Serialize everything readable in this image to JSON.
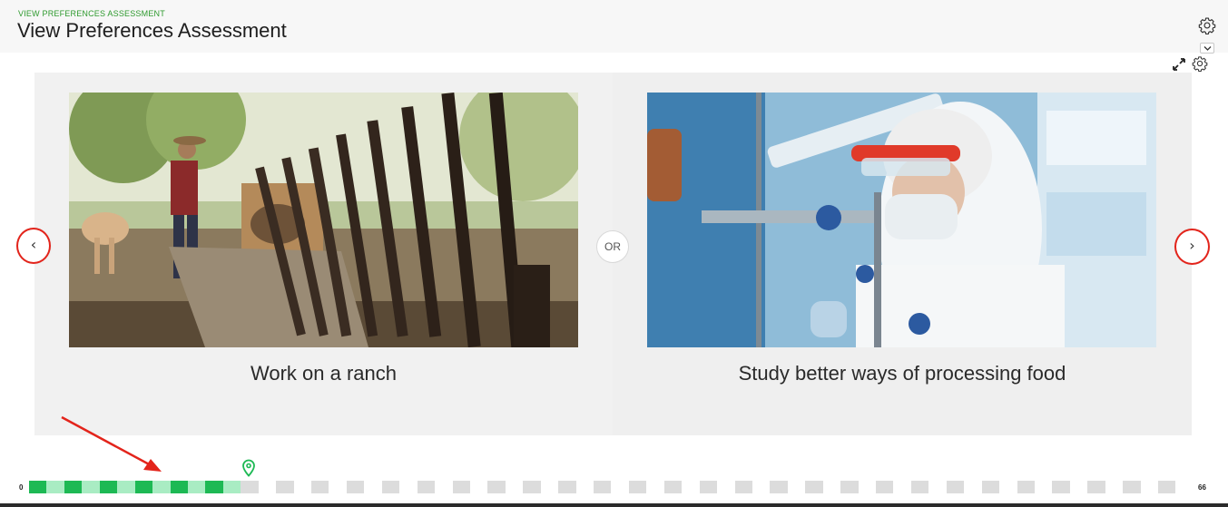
{
  "header": {
    "eyebrow": "VIEW PREFERENCES ASSESSMENT",
    "title": "View Preferences Assessment",
    "icons": [
      "gear-icon",
      "chevron-down-icon",
      "expand-icon",
      "gear-icon"
    ]
  },
  "comparison": {
    "left": {
      "caption": "Work on a ranch"
    },
    "separator": "OR",
    "right": {
      "caption": "Study better ways of processing food"
    }
  },
  "navigation": {
    "prev_symbol": "‹",
    "next_symbol": "›",
    "highlight_color": "#e3241b"
  },
  "progress": {
    "min_label": "0",
    "max_label": "66",
    "total_steps": 66,
    "completed_steps": 12,
    "colors": {
      "done_dark": "#1db954",
      "done_light": "#a9ecc3",
      "todo_dark": "#dcdcdc",
      "todo_light": "#ffffff"
    },
    "marker_icon": "location-pin-icon"
  },
  "annotation": {
    "arrow_color": "#e3241b"
  }
}
